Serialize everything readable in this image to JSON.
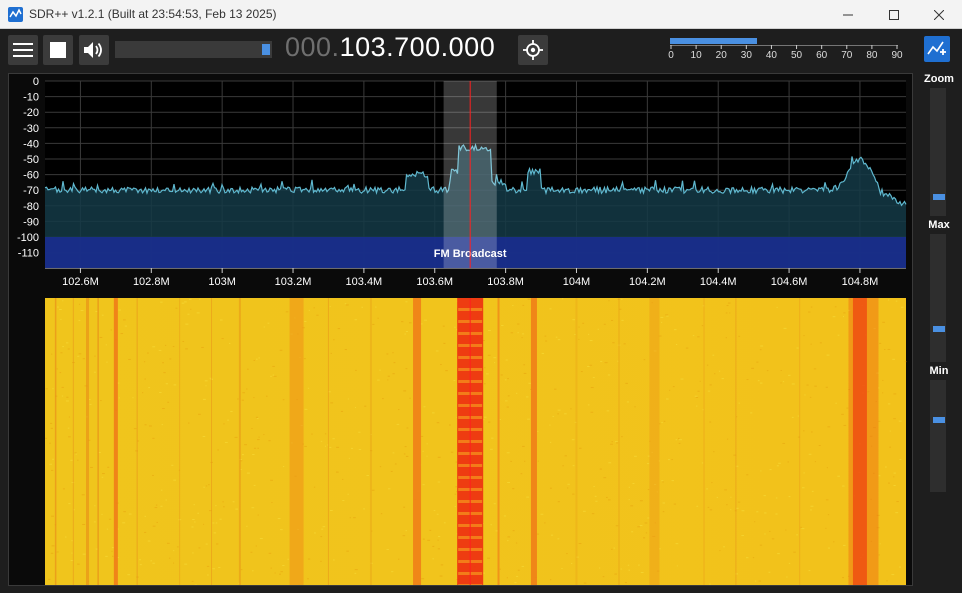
{
  "window": {
    "title": "SDR++ v1.2.1 (Built at 23:54:53, Feb 13 2025)"
  },
  "toolbar": {
    "menu_icon": "hamburger-menu-icon",
    "stop_icon": "stop-square-icon",
    "volume_icon": "speaker-icon",
    "volume_level": 0.96,
    "frequency_prefix": "000.",
    "frequency_main": "103.700.000",
    "center_tuning_icon": "crosshair-target-icon"
  },
  "snr_meter": {
    "value": 35,
    "max": 90,
    "labels": [
      "0",
      "10",
      "20",
      "30",
      "40",
      "50",
      "60",
      "70",
      "80",
      "90"
    ],
    "color": "#4a90e2"
  },
  "spectrum": {
    "y_labels": [
      "0",
      "-10",
      "-20",
      "-30",
      "-40",
      "-50",
      "-60",
      "-70",
      "-80",
      "-90",
      "-100",
      "-110"
    ],
    "x_labels": [
      "102.6M",
      "102.8M",
      "103M",
      "103.2M",
      "103.4M",
      "103.6M",
      "103.8M",
      "104M",
      "104.2M",
      "104.4M",
      "104.6M",
      "104.8M"
    ],
    "band_label": "FM Broadcast",
    "band_color": "#1a2d8f",
    "trace_color": "#5fb8cf",
    "selected_frequency": "103.700.000"
  },
  "side_panel": {
    "expand_icon": "fullscreen-expand-icon",
    "zoom_label": "Zoom",
    "max_label": "Max",
    "min_label": "Min",
    "zoom_level": 0.87,
    "max_level": 0.75,
    "min_level": 0.35
  }
}
